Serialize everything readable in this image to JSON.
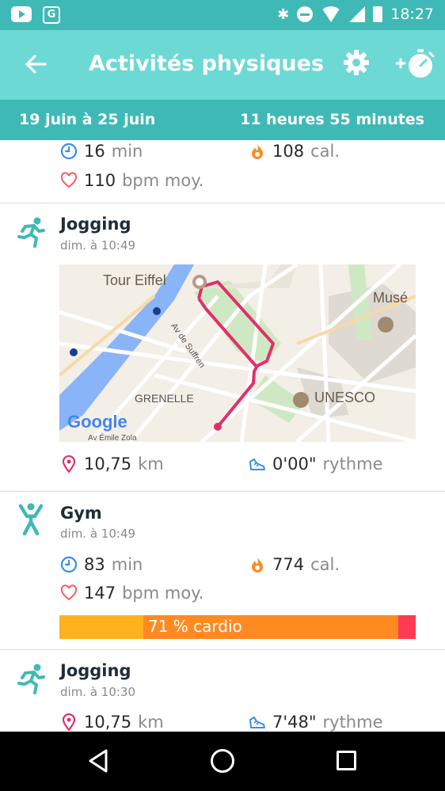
{
  "status_bar": {
    "time": "18:27"
  },
  "app_bar": {
    "title": "Activités physiques"
  },
  "date_range": {
    "range": "19 juin à 25 juin",
    "total": "11 heures 55 minutes"
  },
  "colors": {
    "teal": "#6dd9d4",
    "teal_dark": "#3fb9b6",
    "route": "#e0306a",
    "cardio": "#ff8a22",
    "fat_burn": "#ffb21d",
    "peak": "#ff3b52"
  },
  "activities": [
    {
      "duration_value": "16",
      "duration_unit": "min",
      "calories_value": "108",
      "calories_unit": "cal.",
      "heart_value": "110",
      "heart_unit": "bpm moy."
    },
    {
      "name": "Jogging",
      "time": "dim. à 10:49",
      "icon": "runner-icon",
      "map": {
        "labels": [
          "Tour Eiffel",
          "Musé",
          "Av de Suffren",
          "GRENELLE",
          "UNESCO"
        ],
        "logo": "Google",
        "street": "Av Émile Zola"
      },
      "distance_value": "10,75",
      "distance_unit": "km",
      "pace_value": "0'00\"",
      "pace_unit": "rythme"
    },
    {
      "name": "Gym",
      "time": "dim. à 10:49",
      "icon": "gym-person-icon",
      "duration_value": "83",
      "duration_unit": "min",
      "calories_value": "774",
      "calories_unit": "cal.",
      "heart_value": "147",
      "heart_unit": "bpm moy.",
      "cardio_label": "71 % cardio",
      "zones": [
        {
          "name": "fat_burn",
          "fraction": 0.236
        },
        {
          "name": "cardio",
          "fraction": 0.715
        },
        {
          "name": "peak",
          "fraction": 0.049
        }
      ]
    },
    {
      "name": "Jogging",
      "time": "dim. à 10:30",
      "icon": "runner-icon",
      "distance_value": "10,75",
      "distance_unit": "km",
      "pace_value": "7'48\"",
      "pace_unit": "rythme"
    }
  ]
}
